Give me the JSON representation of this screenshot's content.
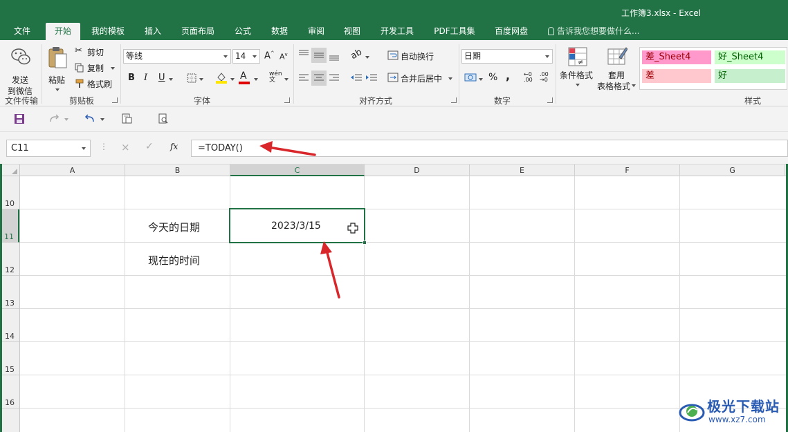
{
  "window": {
    "title": "工作簿3.xlsx - Excel"
  },
  "menu": {
    "tabs": [
      {
        "label": "文件",
        "active": false
      },
      {
        "label": "开始",
        "active": true
      },
      {
        "label": "我的模板",
        "active": false
      },
      {
        "label": "插入",
        "active": false
      },
      {
        "label": "页面布局",
        "active": false
      },
      {
        "label": "公式",
        "active": false
      },
      {
        "label": "数据",
        "active": false
      },
      {
        "label": "审阅",
        "active": false
      },
      {
        "label": "视图",
        "active": false
      },
      {
        "label": "开发工具",
        "active": false
      },
      {
        "label": "PDF工具集",
        "active": false
      },
      {
        "label": "百度网盘",
        "active": false
      }
    ],
    "tell_me": "告诉我您想要做什么..."
  },
  "ribbon": {
    "groups": {
      "file_transfer": "文件传输",
      "clipboard": "剪贴板",
      "font": "字体",
      "alignment": "对齐方式",
      "number": "数字",
      "styles": "样式"
    },
    "send_wechat": [
      "发送",
      "到微信"
    ],
    "paste": "粘贴",
    "cut": "剪切",
    "copy": "复制",
    "format_painter": "格式刷",
    "font_name": "等线",
    "font_size": "14",
    "bold": "B",
    "italic": "I",
    "underline": "U",
    "phonetic": "wén",
    "wrap_text": "自动换行",
    "merge_center": "合并后居中",
    "number_format": "日期",
    "percent": "%",
    "comma": ",",
    "conditional_format": "条件格式",
    "table_format": [
      "套用",
      "表格格式"
    ],
    "styles": [
      {
        "label": "差_Sheet4",
        "bg": "#ff99cc",
        "color": "#9c0006"
      },
      {
        "label": "好_Sheet4",
        "bg": "#ccffcc",
        "color": "#006100"
      },
      {
        "label": "差",
        "bg": "#ffc7ce",
        "color": "#9c0006"
      },
      {
        "label": "好",
        "bg": "#c6efce",
        "color": "#006100"
      }
    ]
  },
  "formula_bar": {
    "name_box": "C11",
    "cancel": "×",
    "enter": "✓",
    "fx": "fx",
    "formula": "=TODAY()"
  },
  "grid": {
    "columns": [
      "A",
      "B",
      "C",
      "D",
      "E",
      "F",
      "G"
    ],
    "selected_column": "C",
    "rows": [
      "10",
      "11",
      "12",
      "13",
      "14",
      "15",
      "16"
    ],
    "selected_row": "11",
    "cells": {
      "B11": "今天的日期",
      "C11": "2023/3/15",
      "B12": "现在的时间"
    }
  },
  "watermark": {
    "title": "极光下载站",
    "url": "www.xz7.com"
  },
  "colors": {
    "accent": "#217346",
    "arrow": "#d9262a"
  }
}
